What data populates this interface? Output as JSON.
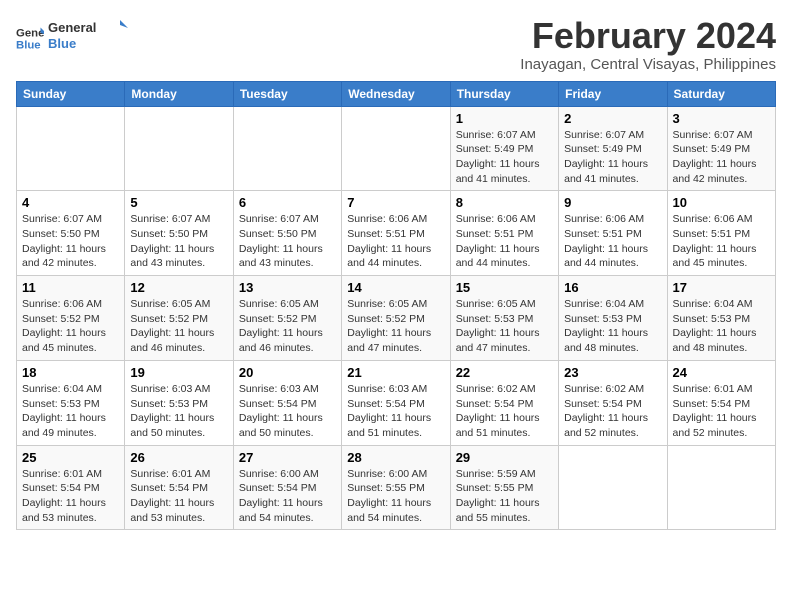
{
  "logo": {
    "line1": "General",
    "line2": "Blue"
  },
  "title": "February 2024",
  "subtitle": "Inayagan, Central Visayas, Philippines",
  "days_header": [
    "Sunday",
    "Monday",
    "Tuesday",
    "Wednesday",
    "Thursday",
    "Friday",
    "Saturday"
  ],
  "weeks": [
    [
      {
        "day": "",
        "info": ""
      },
      {
        "day": "",
        "info": ""
      },
      {
        "day": "",
        "info": ""
      },
      {
        "day": "",
        "info": ""
      },
      {
        "day": "1",
        "info": "Sunrise: 6:07 AM\nSunset: 5:49 PM\nDaylight: 11 hours and 41 minutes."
      },
      {
        "day": "2",
        "info": "Sunrise: 6:07 AM\nSunset: 5:49 PM\nDaylight: 11 hours and 41 minutes."
      },
      {
        "day": "3",
        "info": "Sunrise: 6:07 AM\nSunset: 5:49 PM\nDaylight: 11 hours and 42 minutes."
      }
    ],
    [
      {
        "day": "4",
        "info": "Sunrise: 6:07 AM\nSunset: 5:50 PM\nDaylight: 11 hours and 42 minutes."
      },
      {
        "day": "5",
        "info": "Sunrise: 6:07 AM\nSunset: 5:50 PM\nDaylight: 11 hours and 43 minutes."
      },
      {
        "day": "6",
        "info": "Sunrise: 6:07 AM\nSunset: 5:50 PM\nDaylight: 11 hours and 43 minutes."
      },
      {
        "day": "7",
        "info": "Sunrise: 6:06 AM\nSunset: 5:51 PM\nDaylight: 11 hours and 44 minutes."
      },
      {
        "day": "8",
        "info": "Sunrise: 6:06 AM\nSunset: 5:51 PM\nDaylight: 11 hours and 44 minutes."
      },
      {
        "day": "9",
        "info": "Sunrise: 6:06 AM\nSunset: 5:51 PM\nDaylight: 11 hours and 44 minutes."
      },
      {
        "day": "10",
        "info": "Sunrise: 6:06 AM\nSunset: 5:51 PM\nDaylight: 11 hours and 45 minutes."
      }
    ],
    [
      {
        "day": "11",
        "info": "Sunrise: 6:06 AM\nSunset: 5:52 PM\nDaylight: 11 hours and 45 minutes."
      },
      {
        "day": "12",
        "info": "Sunrise: 6:05 AM\nSunset: 5:52 PM\nDaylight: 11 hours and 46 minutes."
      },
      {
        "day": "13",
        "info": "Sunrise: 6:05 AM\nSunset: 5:52 PM\nDaylight: 11 hours and 46 minutes."
      },
      {
        "day": "14",
        "info": "Sunrise: 6:05 AM\nSunset: 5:52 PM\nDaylight: 11 hours and 47 minutes."
      },
      {
        "day": "15",
        "info": "Sunrise: 6:05 AM\nSunset: 5:53 PM\nDaylight: 11 hours and 47 minutes."
      },
      {
        "day": "16",
        "info": "Sunrise: 6:04 AM\nSunset: 5:53 PM\nDaylight: 11 hours and 48 minutes."
      },
      {
        "day": "17",
        "info": "Sunrise: 6:04 AM\nSunset: 5:53 PM\nDaylight: 11 hours and 48 minutes."
      }
    ],
    [
      {
        "day": "18",
        "info": "Sunrise: 6:04 AM\nSunset: 5:53 PM\nDaylight: 11 hours and 49 minutes."
      },
      {
        "day": "19",
        "info": "Sunrise: 6:03 AM\nSunset: 5:53 PM\nDaylight: 11 hours and 50 minutes."
      },
      {
        "day": "20",
        "info": "Sunrise: 6:03 AM\nSunset: 5:54 PM\nDaylight: 11 hours and 50 minutes."
      },
      {
        "day": "21",
        "info": "Sunrise: 6:03 AM\nSunset: 5:54 PM\nDaylight: 11 hours and 51 minutes."
      },
      {
        "day": "22",
        "info": "Sunrise: 6:02 AM\nSunset: 5:54 PM\nDaylight: 11 hours and 51 minutes."
      },
      {
        "day": "23",
        "info": "Sunrise: 6:02 AM\nSunset: 5:54 PM\nDaylight: 11 hours and 52 minutes."
      },
      {
        "day": "24",
        "info": "Sunrise: 6:01 AM\nSunset: 5:54 PM\nDaylight: 11 hours and 52 minutes."
      }
    ],
    [
      {
        "day": "25",
        "info": "Sunrise: 6:01 AM\nSunset: 5:54 PM\nDaylight: 11 hours and 53 minutes."
      },
      {
        "day": "26",
        "info": "Sunrise: 6:01 AM\nSunset: 5:54 PM\nDaylight: 11 hours and 53 minutes."
      },
      {
        "day": "27",
        "info": "Sunrise: 6:00 AM\nSunset: 5:54 PM\nDaylight: 11 hours and 54 minutes."
      },
      {
        "day": "28",
        "info": "Sunrise: 6:00 AM\nSunset: 5:55 PM\nDaylight: 11 hours and 54 minutes."
      },
      {
        "day": "29",
        "info": "Sunrise: 5:59 AM\nSunset: 5:55 PM\nDaylight: 11 hours and 55 minutes."
      },
      {
        "day": "",
        "info": ""
      },
      {
        "day": "",
        "info": ""
      }
    ]
  ]
}
